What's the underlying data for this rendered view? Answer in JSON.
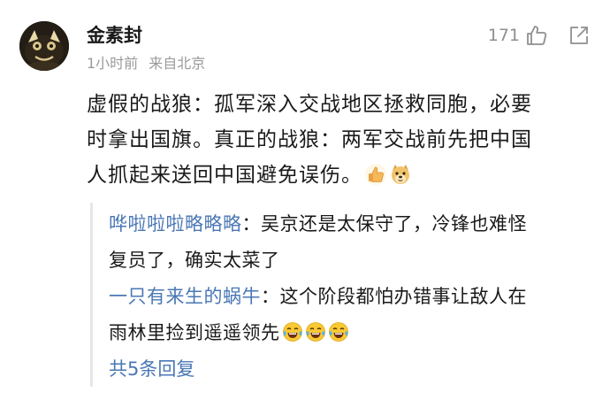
{
  "comment": {
    "username": "金素封",
    "time": "1小时前",
    "location": "来自北京",
    "like_count": "171",
    "text_line1": "虚假的战狼：孤军深入交战地区拯救同胞，必要",
    "text_line2": "时拿出国旗。真正的战狼：两军交战前先把中国",
    "text_line3": "人抓起来送回中国避免误伤。",
    "emojis": [
      "thumbs-up-icon",
      "doge-icon"
    ]
  },
  "replies": [
    {
      "author": "哗啦啦啦略略略",
      "separator": "：",
      "text_line1": "吴京还是太保守了，冷锋也难怪",
      "text_line2": "复员了，确实太菜了"
    },
    {
      "author": "一只有来生的蜗牛",
      "separator": "：",
      "text_line1": "这个阶段都怕办错事让敌人在",
      "text_line2": "雨林里捡到遥遥领先",
      "emojis": [
        "laughing-tears-icon",
        "laughing-tears-icon",
        "laughing-tears-icon"
      ]
    }
  ],
  "more_replies": "共5条回复",
  "colors": {
    "link": "#4a77b4",
    "meta": "#9a9a9a",
    "text": "#1a1a1a"
  }
}
